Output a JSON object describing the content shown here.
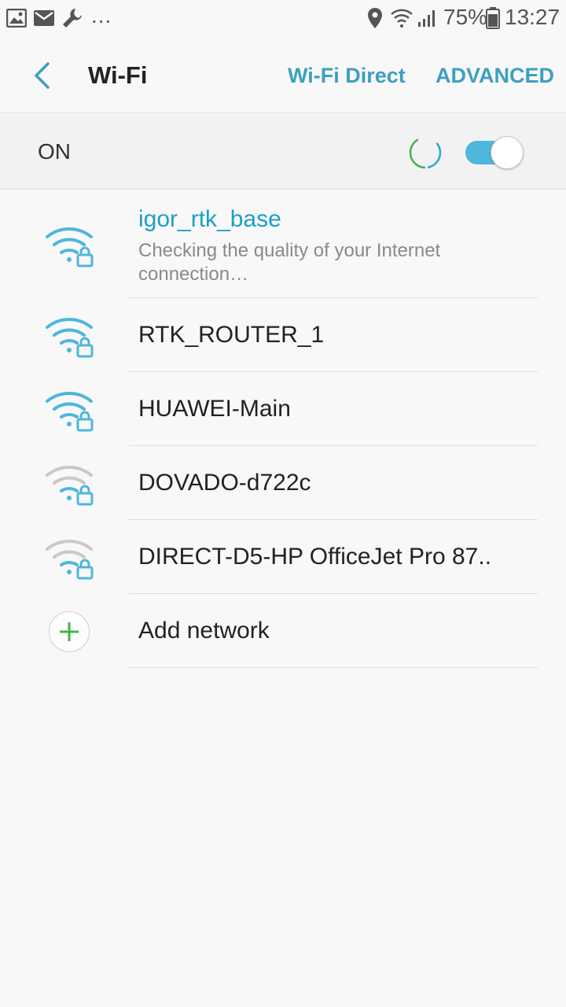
{
  "status_bar": {
    "left_icons": [
      "gallery-icon",
      "email-icon",
      "wrench-icon"
    ],
    "overflow": "...",
    "right_icons": [
      "location-icon",
      "wifi-icon",
      "signal-icon",
      "battery-icon"
    ],
    "battery": "75%",
    "time": "13:27"
  },
  "app_bar": {
    "title": "Wi-Fi",
    "wifi_direct": "Wi-Fi Direct",
    "advanced": "ADVANCED"
  },
  "wifi_switch": {
    "label": "ON",
    "enabled": true,
    "toggle_color": "#4fb6dc"
  },
  "networks": [
    {
      "name": "igor_rtk_base",
      "status": "Checking the quality of your Internet connection…",
      "connected": true,
      "secured": true,
      "signal_color": "#4fb6dc"
    },
    {
      "name": "RTK_ROUTER_1",
      "secured": true,
      "signal_color": "#4fb6dc"
    },
    {
      "name": "HUAWEI-Main",
      "secured": true,
      "signal_color": "#4fb6dc"
    },
    {
      "name": "DOVADO-d722c",
      "secured": true,
      "signal_color": "#c9c9c9"
    },
    {
      "name": "DIRECT-D5-HP OfficeJet Pro 87..",
      "secured": true,
      "signal_color": "#c9c9c9"
    }
  ],
  "add_network": {
    "label": "Add network",
    "icon": "plus-icon",
    "icon_color": "#3fb54a"
  },
  "colors": {
    "accent": "#3d9fc0",
    "connected_text": "#1b9fc9"
  }
}
